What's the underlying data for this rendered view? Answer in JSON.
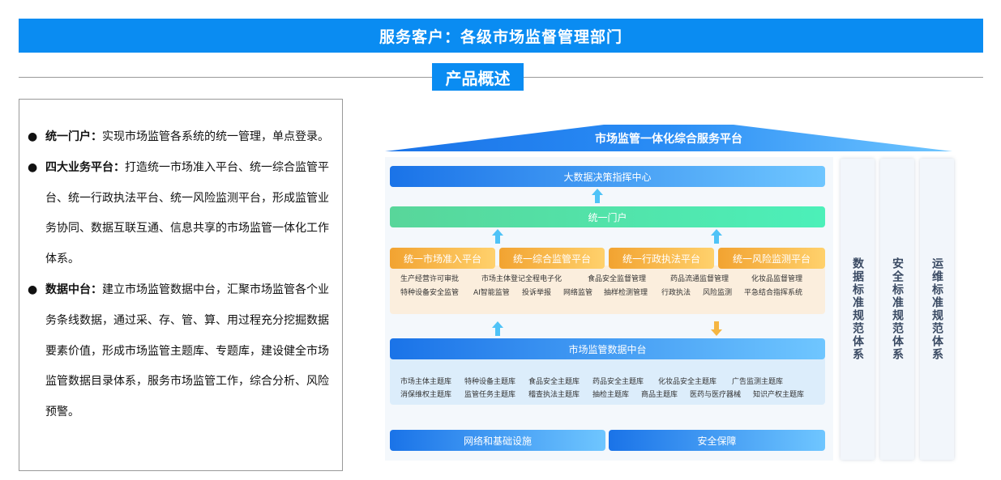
{
  "banner": {
    "title": "服务客户：各级市场监督管理部门"
  },
  "overview": {
    "title": "产品概述"
  },
  "bullets": [
    {
      "title": "统一门户：",
      "text": "实现市场监管各系统的统一管理，单点登录。"
    },
    {
      "title": "四大业务平台：",
      "text": "打造统一市场准入平台、统一综合监管平台、统一行政执法平台、统一风险监测平台，形成监管业务协同、数据互联互通、信息共享的市场监管一体化工作体系。"
    },
    {
      "title": "数据中台：",
      "text": "建立市场监管数据中台，汇聚市场监管各个业务条线数据，通过采、存、管、算、用过程充分挖掘数据要素价值，形成市场监管主题库、专题库，建设健全市场监管数据目录体系，服务市场监管工作，综合分析、风险预警。"
    }
  ],
  "diagram": {
    "roof_title": "市场监管一体化综合服务平台",
    "decision_center": "大数据决策指挥中心",
    "portal": "统一门户",
    "platforms": [
      "统一市场准入平台",
      "统一综合监管平台",
      "统一行政执法平台",
      "统一风险监测平台"
    ],
    "business_row1": [
      "生产经营许可审批",
      "市场主体登记全程电子化",
      "食品安全监督管理",
      "药品流通监督管理",
      "化妆品监督管理"
    ],
    "business_row2": [
      "特种设备安全监管",
      "AI智能监管",
      "投诉举报",
      "网络监管",
      "抽样检测管理",
      "行政执法",
      "风险监测",
      "平急结合指挥系统"
    ],
    "data_platform": "市场监管数据中台",
    "data_row1": [
      "市场主体主题库",
      "特种设备主题库",
      "食品安全主题库",
      "药品安全主题库",
      "化妆品安全主题库",
      "广告监测主题库"
    ],
    "data_row2": [
      "消保维权主题库",
      "监管任务主题库",
      "稽查执法主题库",
      "抽检主题库",
      "商品主题库",
      "医药与医疗器械",
      "知识产权主题库"
    ],
    "infrastructure": "网络和基础设施",
    "security": "安全保障",
    "pillars": [
      "数据标准规范体系",
      "安全标准规范体系",
      "运维标准规范体系"
    ]
  },
  "colors": {
    "brand_blue": "#0a8cf2",
    "green": "#4cf0b9",
    "orange": "#f2a331"
  }
}
